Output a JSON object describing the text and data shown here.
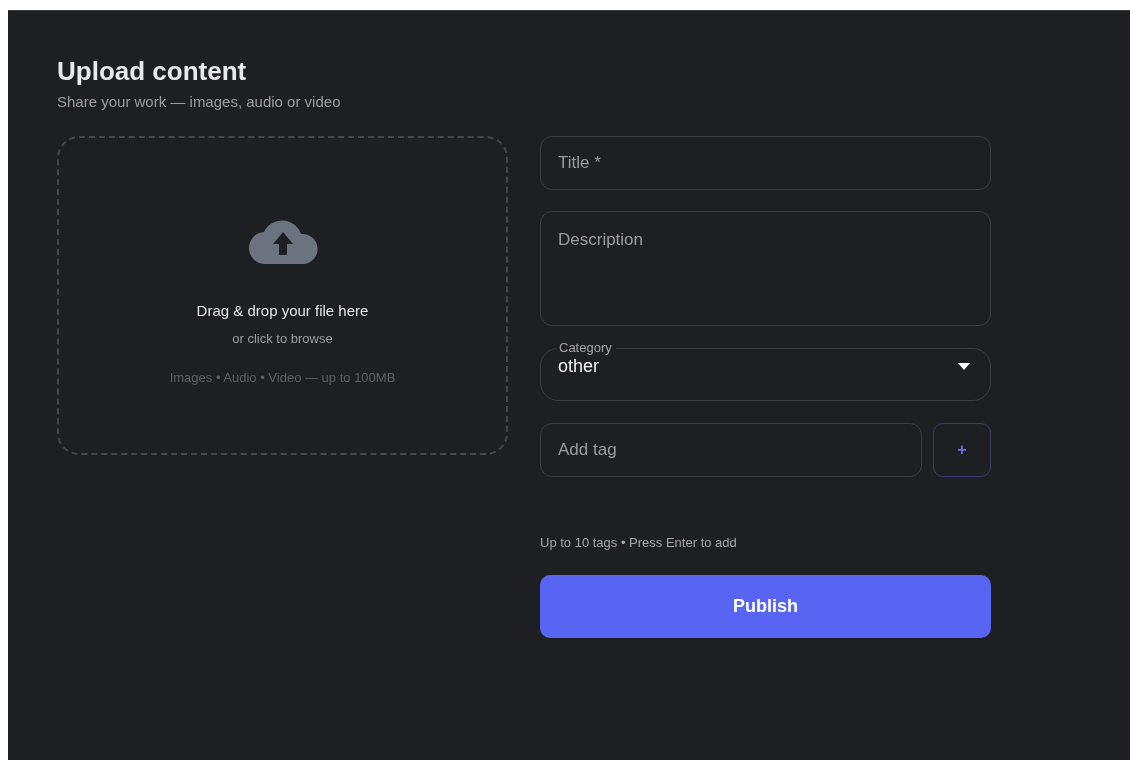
{
  "header": {
    "title": "Upload content",
    "subtitle": "Share your work — images, audio or video"
  },
  "dropzone": {
    "headline": "Drag & drop your file here",
    "action": "or click to browse",
    "formats": "Images • Audio • Video — up to 100MB"
  },
  "form": {
    "title_field": {
      "placeholder": "Title *"
    },
    "description_field": {
      "placeholder": "Description"
    },
    "category": {
      "label": "Category",
      "value": "other"
    },
    "tag_field": {
      "placeholder": "Add tag"
    },
    "add_tag_button": "+",
    "hint": "Up to 10 tags • Press Enter to add",
    "submit_button": "Publish"
  }
}
